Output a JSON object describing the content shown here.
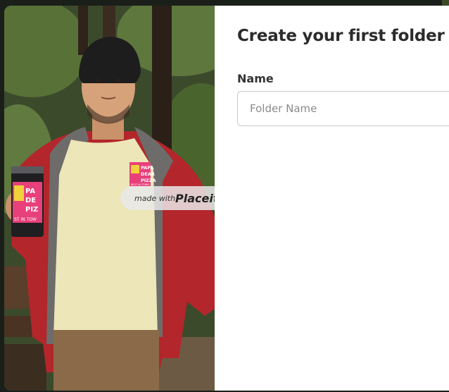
{
  "dialog": {
    "title": "Create your first folder",
    "name_label": "Name",
    "name_placeholder": "Folder Name",
    "name_value": ""
  },
  "mockup": {
    "watermark_prefix": "made with",
    "watermark_brand": "Placeit",
    "shirt_logo_lines": [
      "PAPA",
      "DEAR",
      "PIZZA"
    ],
    "shirt_logo_tagline": "BEST IN TOWN",
    "cup_logo_lines": [
      "PA",
      "DE",
      "PIZ"
    ],
    "cup_logo_tagline": "ST IN TOW"
  },
  "colors": {
    "jacket": "#b3262b",
    "shirt": "#ece6b8",
    "pants": "#8a6a48",
    "beanie": "#1d1d1d",
    "logo_pink": "#e8407a",
    "logo_yellow": "#f2d23a"
  }
}
